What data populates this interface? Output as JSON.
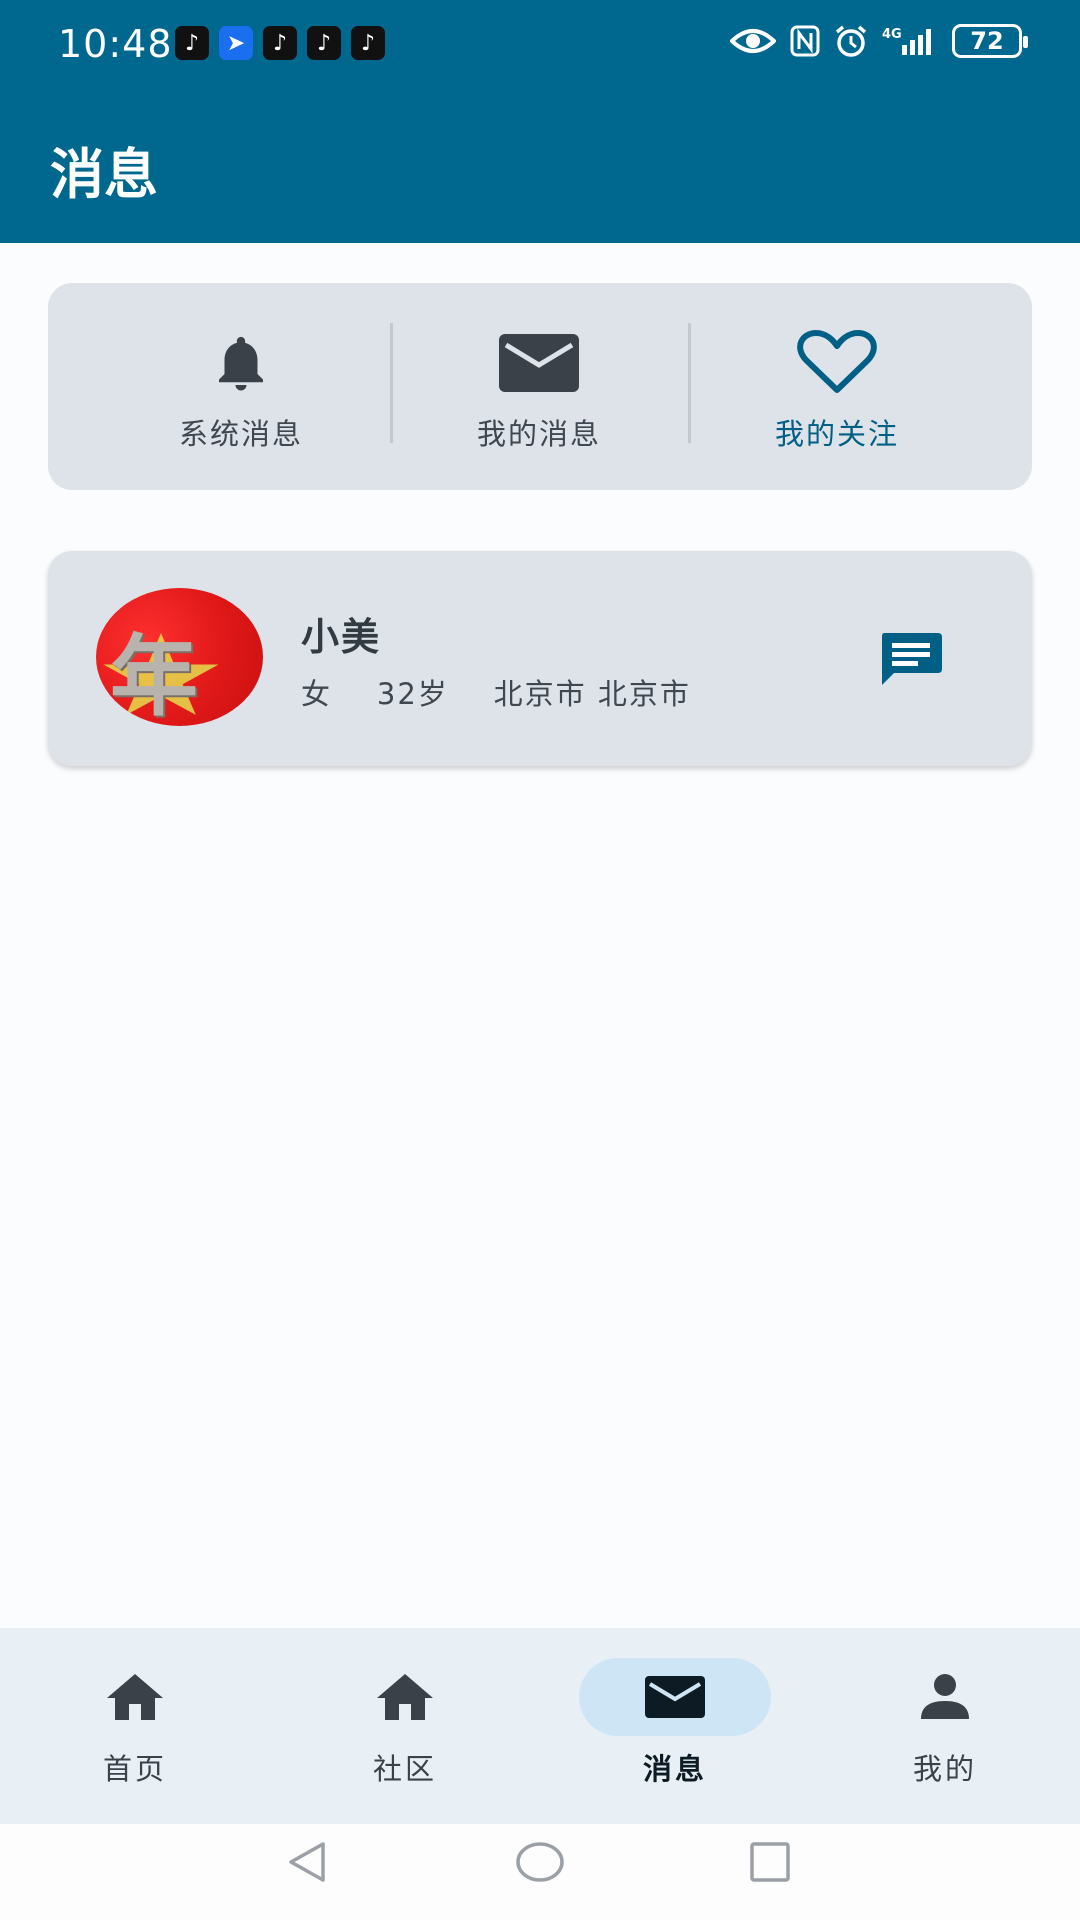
{
  "status_bar": {
    "time": "10:48",
    "notifications": [
      "tiktok-icon",
      "bird-app-icon",
      "tiktok-icon",
      "tiktok-icon",
      "tiktok-icon"
    ],
    "battery": "72",
    "network": "4G"
  },
  "header": {
    "title": "消息"
  },
  "tabs": [
    {
      "label": "系统消息",
      "icon": "bell-icon",
      "active": false
    },
    {
      "label": "我的消息",
      "icon": "envelope-icon",
      "active": false
    },
    {
      "label": "我的关注",
      "icon": "heart-icon",
      "active": true
    }
  ],
  "follow_list": [
    {
      "name": "小美",
      "gender": "女",
      "age": "32岁",
      "location": "北京市 北京市",
      "avatar_text": "年"
    }
  ],
  "bottom_nav": [
    {
      "label": "首页",
      "icon": "home-icon",
      "active": false
    },
    {
      "label": "社区",
      "icon": "home-icon",
      "active": false
    },
    {
      "label": "消息",
      "icon": "envelope-icon",
      "active": true
    },
    {
      "label": "我的",
      "icon": "person-icon",
      "active": false
    }
  ],
  "colors": {
    "primary": "#00678e",
    "card": "#dee3ea",
    "active_pill": "#cde5f5",
    "background": "#fbfcfe"
  }
}
